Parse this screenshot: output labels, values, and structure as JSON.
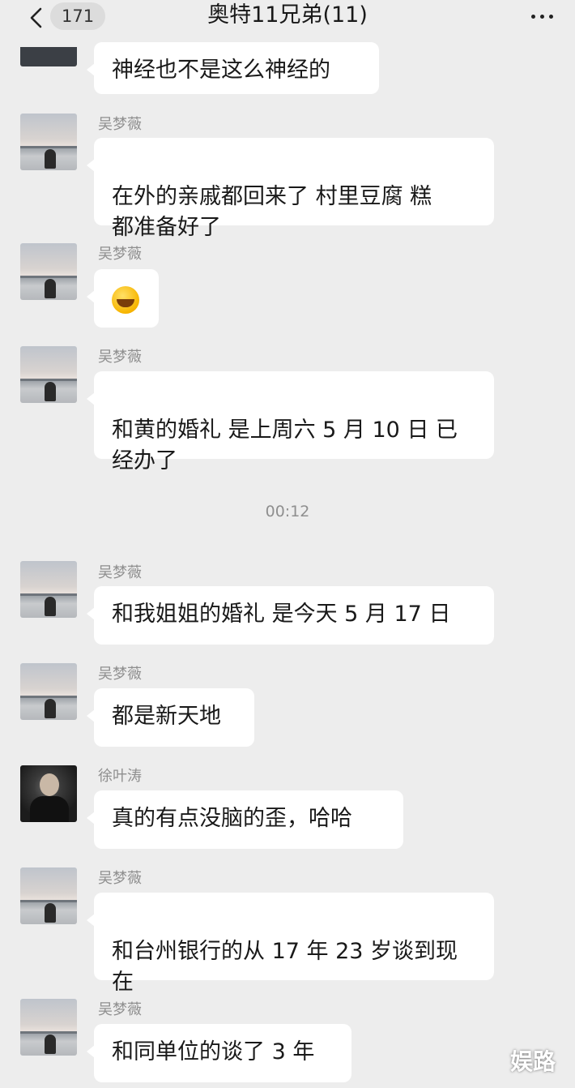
{
  "header": {
    "back_count": "171",
    "title": "奥特11兄弟(11)"
  },
  "timestamp": "00:12",
  "messages": [
    {
      "text": "神经也不是这么神经的"
    },
    {
      "sender": "吴梦薇",
      "text": "在外的亲戚都回来了 村里豆腐 糕\n都准备好了"
    },
    {
      "sender": "吴梦薇",
      "emoji": "crying-laughing-emoji"
    },
    {
      "sender": "吴梦薇",
      "text": "和黄的婚礼 是上周六 5 月 10 日 已\n经办了"
    },
    {
      "sender": "吴梦薇",
      "text": "和我姐姐的婚礼 是今天 5 月 17 日"
    },
    {
      "sender": "吴梦薇",
      "text": "都是新天地"
    },
    {
      "sender": "徐叶涛",
      "text": "真的有点没脑的歪，哈哈"
    },
    {
      "sender": "吴梦薇",
      "text": "和台州银行的从 17 年 23 岁谈到现\n在"
    },
    {
      "sender": "吴梦薇",
      "text": "和同单位的谈了 3 年"
    }
  ],
  "watermark": "娱路"
}
